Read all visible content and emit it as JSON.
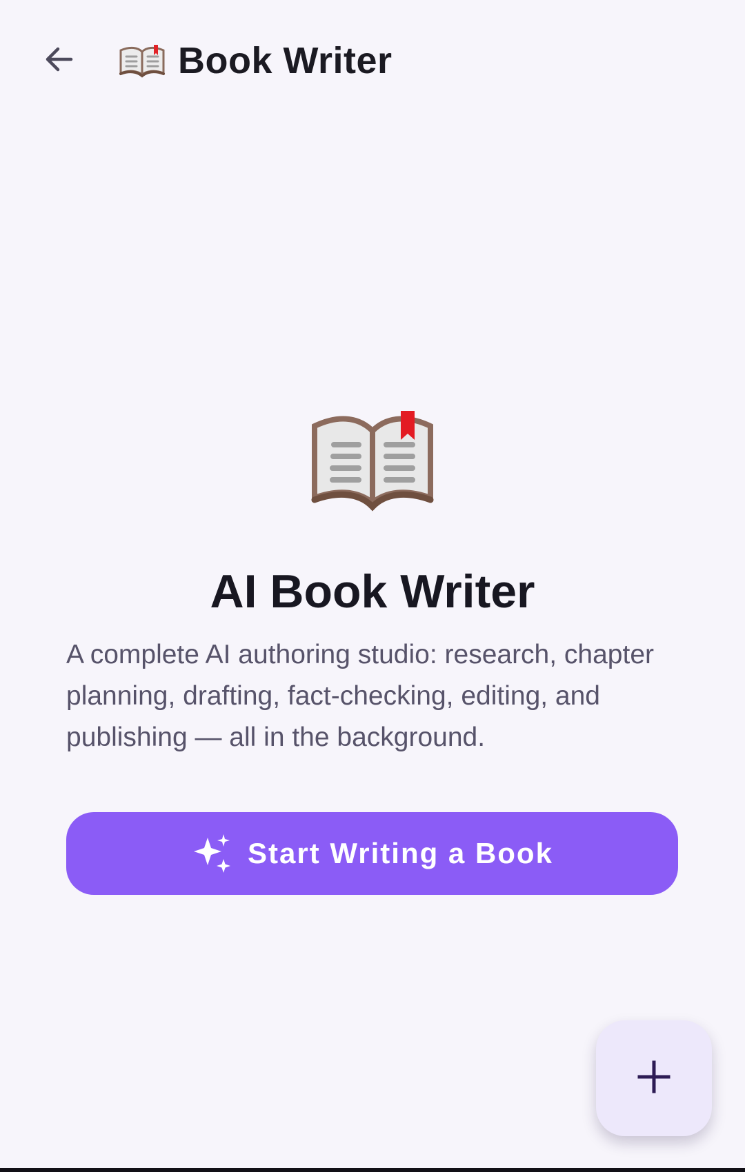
{
  "header": {
    "back_icon": "arrow-back-icon",
    "title_icon": "open-book-icon",
    "title": "Book Writer"
  },
  "hero": {
    "icon": "open-book-icon",
    "title": "AI Book Writer",
    "description": "A complete AI authoring studio: research, chapter planning, drafting, fact-checking, editing, and publishing — all in the background."
  },
  "primary_action": {
    "icon": "sparkles-icon",
    "label": "Start Writing a Book",
    "background": "#8b5cf6",
    "text_color": "#ffffff"
  },
  "fab": {
    "icon": "plus-icon",
    "background": "#ede8fb",
    "icon_color": "#2d1b54"
  },
  "colors": {
    "page_background": "#f7f5fb",
    "title_text": "#1b1a22",
    "body_text": "#57536a"
  }
}
